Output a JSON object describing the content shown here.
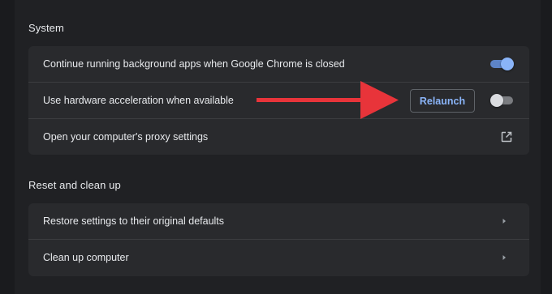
{
  "sections": [
    {
      "title": "System",
      "rows": [
        {
          "label": "Continue running background apps when Google Chrome is closed",
          "control": "toggle",
          "checked": true
        },
        {
          "label": "Use hardware acceleration when available",
          "control": "toggle",
          "checked": false,
          "button": "Relaunch"
        },
        {
          "label": "Open your computer's proxy settings",
          "control": "external-link-icon"
        }
      ]
    },
    {
      "title": "Reset and clean up",
      "rows": [
        {
          "label": "Restore settings to their original defaults",
          "control": "chevron-right-icon"
        },
        {
          "label": "Clean up computer",
          "control": "chevron-right-icon"
        }
      ]
    }
  ],
  "colors": {
    "background": "#202124",
    "card": "#292a2d",
    "text": "#e8eaed",
    "accent": "#8ab4f8",
    "annotation_arrow": "#e8343a"
  }
}
